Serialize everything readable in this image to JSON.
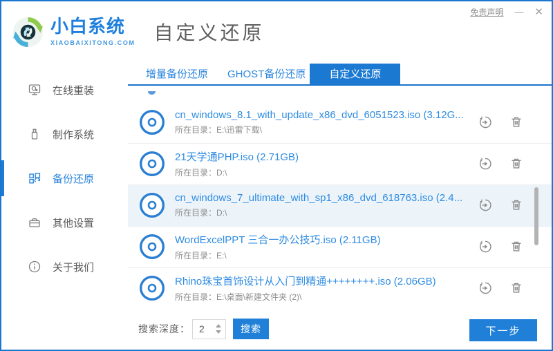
{
  "header": {
    "logo": {
      "brand": "小白系统",
      "domain": "XIAOBAIXITONG.COM",
      "icon": "recycle-sphere-logo"
    },
    "title": "自定义还原",
    "controls": {
      "disclaimer": "免责声明",
      "minimize": "—",
      "close": "✕"
    }
  },
  "sidebar": {
    "items": [
      {
        "label": "在线重装",
        "icon": "monitor-user-icon",
        "active": false
      },
      {
        "label": "制作系统",
        "icon": "usb-drive-icon",
        "active": false
      },
      {
        "label": "备份还原",
        "icon": "grid-restore-icon",
        "active": true
      },
      {
        "label": "其他设置",
        "icon": "briefcase-icon",
        "active": false
      },
      {
        "label": "关于我们",
        "icon": "info-circle-icon",
        "active": false
      }
    ]
  },
  "tabs": [
    {
      "label": "增量备份还原",
      "active": false
    },
    {
      "label": "GHOST备份还原",
      "active": false
    },
    {
      "label": "自定义还原",
      "active": true
    }
  ],
  "list": {
    "items": [
      {
        "name": "cn_windows_8.1_with_update_x86_dvd_6051523.iso (3.12G...",
        "dir": "所在目录：E:\\迅雷下载\\",
        "selected": false
      },
      {
        "name": "21天学通PHP.iso (2.71GB)",
        "dir": "所在目录：D:\\",
        "selected": false
      },
      {
        "name": "cn_windows_7_ultimate_with_sp1_x86_dvd_618763.iso (2.4...",
        "dir": "所在目录：D:\\",
        "selected": true
      },
      {
        "name": "WordExcelPPT 三合一办公技巧.iso (2.11GB)",
        "dir": "所在目录：E:\\",
        "selected": false
      },
      {
        "name": "Rhino珠宝首饰设计从入门到精通++++++++.iso (2.06GB)",
        "dir": "所在目录：E:\\桌面\\新建文件夹 (2)\\",
        "selected": false
      }
    ],
    "row_icons": {
      "item": "disc-icon",
      "restore": "restore-icon",
      "delete": "trash-icon"
    }
  },
  "footer": {
    "depth_label": "搜索深度：",
    "depth_value": "2",
    "search_label": "搜索",
    "next_label": "下一步"
  },
  "colors": {
    "accent_blue": "#1b79d2",
    "filename_blue": "#2f8ce2",
    "row_highlight": "#ecf4fa",
    "border_blue": "#1a77d0",
    "text_gray": "#8c8c8c"
  }
}
